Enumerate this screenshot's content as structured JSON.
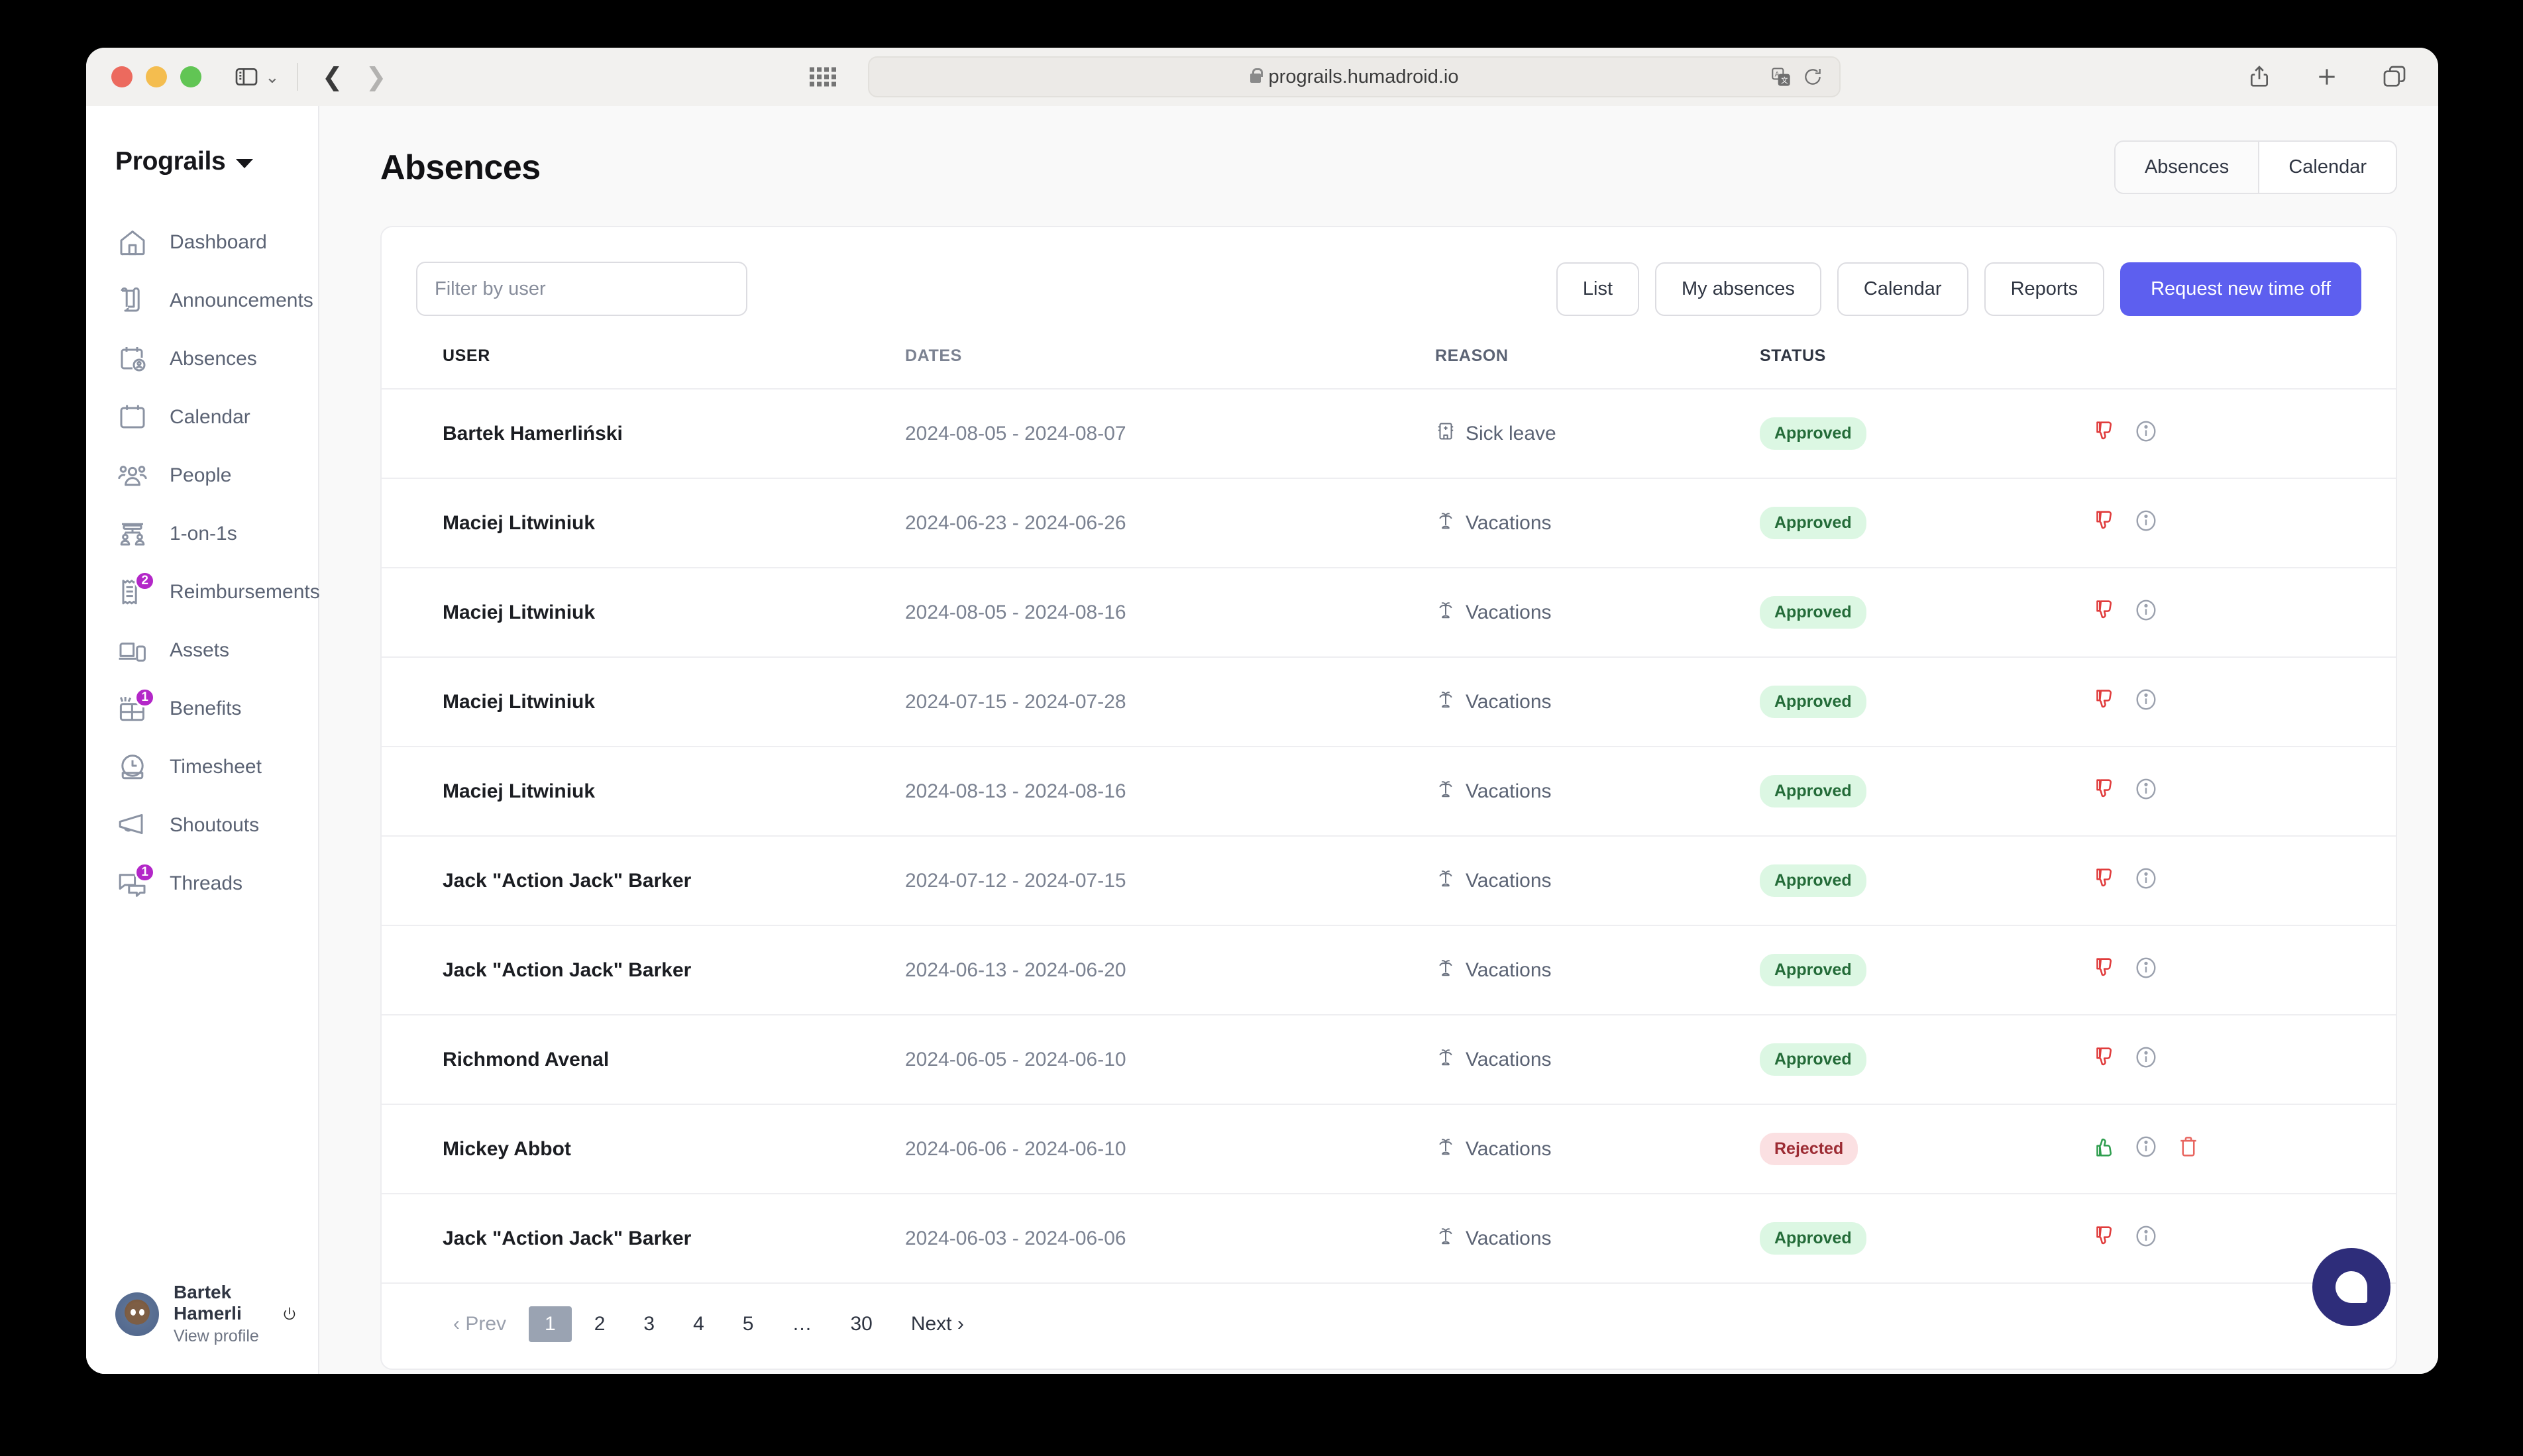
{
  "browser": {
    "url": "prograils.humadroid.io",
    "lock_icon": "lock-icon",
    "sidebar_toggle_icon": "sidebar-toggle-icon",
    "back_icon": "back-arrow-icon",
    "forward_icon": "forward-arrow-icon",
    "apps_grid_icon": "apps-grid-icon",
    "translate_icon": "translate-icon",
    "reload_icon": "reload-icon",
    "share_icon": "share-icon",
    "new_tab_icon": "plus-icon",
    "tabs_icon": "tab-overview-icon"
  },
  "sidebar": {
    "brand": "Prograils",
    "brand_caret_icon": "chevron-down-icon",
    "items": [
      {
        "label": "Dashboard",
        "icon": "home-icon",
        "badge": null
      },
      {
        "label": "Announcements",
        "icon": "scroll-icon",
        "badge": null
      },
      {
        "label": "Absences",
        "icon": "calendar-user-icon",
        "badge": null
      },
      {
        "label": "Calendar",
        "icon": "calendar-icon",
        "badge": null
      },
      {
        "label": "People",
        "icon": "people-icon",
        "badge": null
      },
      {
        "label": "1-on-1s",
        "icon": "one-on-one-icon",
        "badge": null
      },
      {
        "label": "Reimbursements",
        "icon": "receipt-icon",
        "badge": "2"
      },
      {
        "label": "Assets",
        "icon": "laptop-phone-icon",
        "badge": null
      },
      {
        "label": "Benefits",
        "icon": "gift-icon",
        "badge": "1"
      },
      {
        "label": "Timesheet",
        "icon": "clock-icon",
        "badge": null
      },
      {
        "label": "Shoutouts",
        "icon": "megaphone-icon",
        "badge": null
      },
      {
        "label": "Threads",
        "icon": "chat-icon",
        "badge": "1"
      }
    ],
    "profile": {
      "name": "Bartek Hamerli",
      "link": "View profile",
      "avatar_icon": "avatar",
      "logout_icon": "power-icon"
    }
  },
  "header": {
    "title": "Absences",
    "segmented": [
      {
        "label": "Absences",
        "active": true
      },
      {
        "label": "Calendar",
        "active": false
      }
    ]
  },
  "toolbar": {
    "filter_placeholder": "Filter by user",
    "filter_value": "",
    "buttons": [
      {
        "label": "List",
        "primary": false
      },
      {
        "label": "My absences",
        "primary": false
      },
      {
        "label": "Calendar",
        "primary": false
      },
      {
        "label": "Reports",
        "primary": false
      },
      {
        "label": "Request new time off",
        "primary": true
      }
    ]
  },
  "table": {
    "columns": [
      "USER",
      "DATES",
      "REASON",
      "STATUS",
      ""
    ],
    "rows": [
      {
        "user": "Bartek Hamerliński",
        "dates": "2024-08-05 - 2024-08-07",
        "reason": "Sick leave",
        "reason_icon": "hospital-icon",
        "status": "Approved",
        "actions": [
          "thumbs-down-icon",
          "info-icon"
        ]
      },
      {
        "user": "Maciej Litwiniuk",
        "dates": "2024-06-23 - 2024-06-26",
        "reason": "Vacations",
        "reason_icon": "palm-tree-icon",
        "status": "Approved",
        "actions": [
          "thumbs-down-icon",
          "info-icon"
        ]
      },
      {
        "user": "Maciej Litwiniuk",
        "dates": "2024-08-05 - 2024-08-16",
        "reason": "Vacations",
        "reason_icon": "palm-tree-icon",
        "status": "Approved",
        "actions": [
          "thumbs-down-icon",
          "info-icon"
        ]
      },
      {
        "user": "Maciej Litwiniuk",
        "dates": "2024-07-15 - 2024-07-28",
        "reason": "Vacations",
        "reason_icon": "palm-tree-icon",
        "status": "Approved",
        "actions": [
          "thumbs-down-icon",
          "info-icon"
        ]
      },
      {
        "user": "Maciej Litwiniuk",
        "dates": "2024-08-13 - 2024-08-16",
        "reason": "Vacations",
        "reason_icon": "palm-tree-icon",
        "status": "Approved",
        "actions": [
          "thumbs-down-icon",
          "info-icon"
        ]
      },
      {
        "user": "Jack \"Action Jack\" Barker",
        "dates": "2024-07-12 - 2024-07-15",
        "reason": "Vacations",
        "reason_icon": "palm-tree-icon",
        "status": "Approved",
        "actions": [
          "thumbs-down-icon",
          "info-icon"
        ]
      },
      {
        "user": "Jack \"Action Jack\" Barker",
        "dates": "2024-06-13 - 2024-06-20",
        "reason": "Vacations",
        "reason_icon": "palm-tree-icon",
        "status": "Approved",
        "actions": [
          "thumbs-down-icon",
          "info-icon"
        ]
      },
      {
        "user": "Richmond Avenal",
        "dates": "2024-06-05 - 2024-06-10",
        "reason": "Vacations",
        "reason_icon": "palm-tree-icon",
        "status": "Approved",
        "actions": [
          "thumbs-down-icon",
          "info-icon"
        ]
      },
      {
        "user": "Mickey Abbot",
        "dates": "2024-06-06 - 2024-06-10",
        "reason": "Vacations",
        "reason_icon": "palm-tree-icon",
        "status": "Rejected",
        "actions": [
          "thumbs-up-icon",
          "info-icon",
          "trash-icon"
        ]
      },
      {
        "user": "Jack \"Action Jack\" Barker",
        "dates": "2024-06-03 - 2024-06-06",
        "reason": "Vacations",
        "reason_icon": "palm-tree-icon",
        "status": "Approved",
        "actions": [
          "thumbs-down-icon",
          "info-icon"
        ]
      }
    ]
  },
  "pagination": {
    "prev": "‹ Prev",
    "next": "Next ›",
    "pages": [
      "1",
      "2",
      "3",
      "4",
      "5",
      "…",
      "30"
    ],
    "current": "1"
  },
  "chat_widget": {
    "icon": "chat-bubble-icon"
  },
  "colors": {
    "primary": "#5d5fef",
    "badge": "#b327c8",
    "approved_bg": "#dcf7e3",
    "approved_text": "#236b38",
    "rejected_bg": "#fbe0e2",
    "rejected_text": "#9c2b33",
    "chat": "#2e2d7a"
  }
}
